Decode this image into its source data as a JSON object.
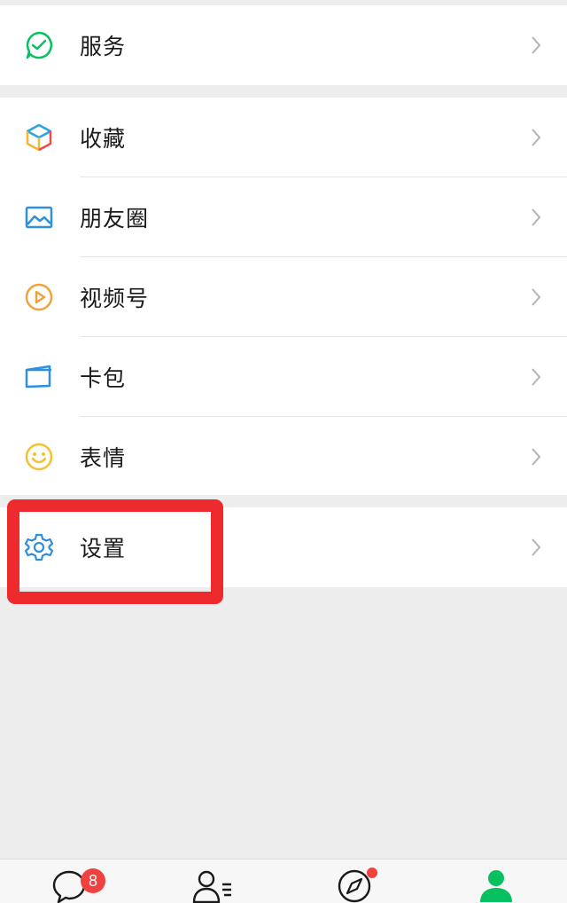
{
  "menu": {
    "service": {
      "label": "服务",
      "icon": "service-icon"
    },
    "items": [
      {
        "label": "收藏",
        "icon": "favorites-cube-icon"
      },
      {
        "label": "朋友圈",
        "icon": "moments-image-icon"
      },
      {
        "label": "视频号",
        "icon": "channels-play-icon"
      },
      {
        "label": "卡包",
        "icon": "card-wallet-icon"
      },
      {
        "label": "表情",
        "icon": "sticker-smile-icon"
      }
    ],
    "settings": {
      "label": "设置",
      "icon": "gear-icon"
    }
  },
  "tabbar": {
    "chats_badge": "8",
    "tabs": [
      {
        "icon": "chat-bubble-icon"
      },
      {
        "icon": "contacts-icon"
      },
      {
        "icon": "discover-compass-icon"
      },
      {
        "icon": "me-person-icon",
        "active": true
      }
    ]
  },
  "colors": {
    "background": "#ededed",
    "highlight": "#ee2a2f",
    "active_tab": "#07c160",
    "badge": "#f04040"
  }
}
